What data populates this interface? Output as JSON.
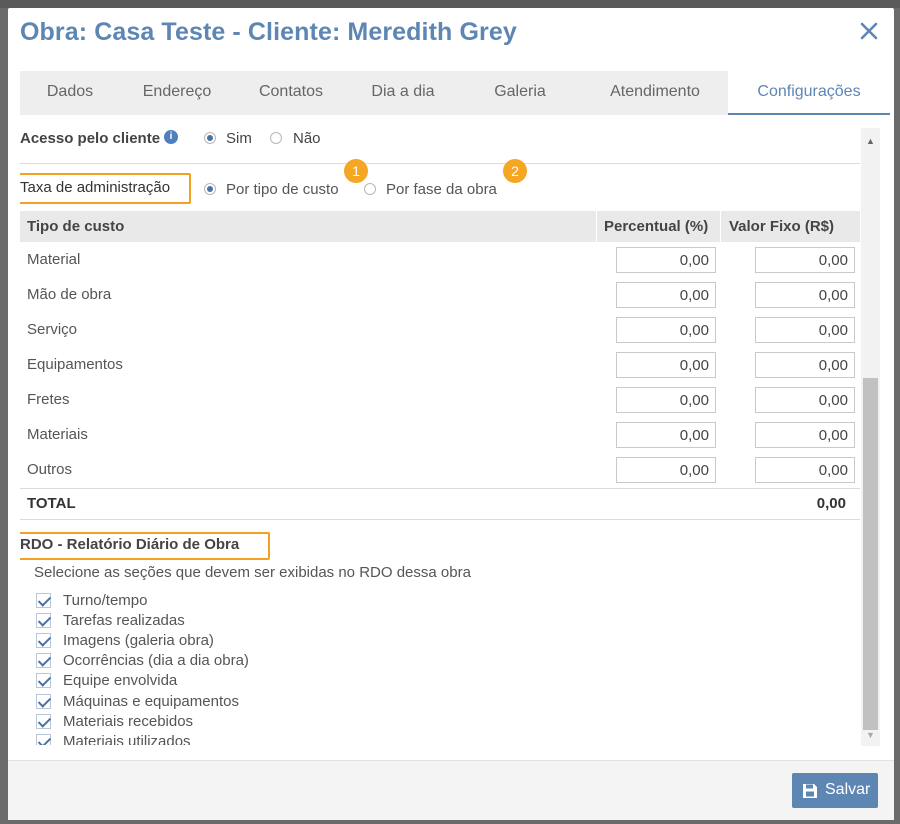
{
  "modal": {
    "title": "Obra: Casa Teste - Cliente: Meredith Grey",
    "close_icon": "close-icon"
  },
  "tabs": [
    {
      "label": "Dados"
    },
    {
      "label": "Endereço"
    },
    {
      "label": "Contatos"
    },
    {
      "label": "Dia a dia"
    },
    {
      "label": "Galeria"
    },
    {
      "label": "Atendimento"
    },
    {
      "label": "Configurações",
      "active": true
    }
  ],
  "access": {
    "label": "Acesso pelo cliente",
    "info_icon": "info-icon",
    "options": [
      "Sim",
      "Não"
    ],
    "selected": "Sim"
  },
  "admin_fee": {
    "label": "Taxa de administração",
    "options": [
      "Por tipo de custo",
      "Por fase da obra"
    ],
    "selected": "Por tipo de custo",
    "badges": [
      "1",
      "2"
    ]
  },
  "cost_table": {
    "headers": [
      "Tipo de custo",
      "Percentual (%)",
      "Valor Fixo (R$)"
    ],
    "rows": [
      {
        "name": "Material",
        "percent": "0,00",
        "fixed": "0,00"
      },
      {
        "name": "Mão de obra",
        "percent": "0,00",
        "fixed": "0,00"
      },
      {
        "name": "Serviço",
        "percent": "0,00",
        "fixed": "0,00"
      },
      {
        "name": "Equipamentos",
        "percent": "0,00",
        "fixed": "0,00"
      },
      {
        "name": "Fretes",
        "percent": "0,00",
        "fixed": "0,00"
      },
      {
        "name": "Materiais",
        "percent": "0,00",
        "fixed": "0,00"
      },
      {
        "name": "Outros",
        "percent": "0,00",
        "fixed": "0,00"
      }
    ],
    "total_label": "TOTAL",
    "total_value": "0,00"
  },
  "rdo": {
    "title": "RDO - Relatório Diário de Obra",
    "subtitle": "Selecione as seções que devem ser exibidas no RDO dessa obra",
    "items": [
      {
        "label": "Turno/tempo",
        "checked": true
      },
      {
        "label": "Tarefas realizadas",
        "checked": true
      },
      {
        "label": "Imagens (galeria obra)",
        "checked": true
      },
      {
        "label": "Ocorrências (dia a dia obra)",
        "checked": true
      },
      {
        "label": "Equipe envolvida",
        "checked": true
      },
      {
        "label": "Máquinas e equipamentos",
        "checked": true
      },
      {
        "label": "Materiais recebidos",
        "checked": true
      },
      {
        "label": "Materiais utilizados",
        "checked": true
      }
    ]
  },
  "footer": {
    "save_label": "Salvar",
    "save_icon": "floppy-disk-icon"
  },
  "colors": {
    "accent": "#5d86b3",
    "highlight": "#f3a023",
    "badge": "#f5a623"
  }
}
